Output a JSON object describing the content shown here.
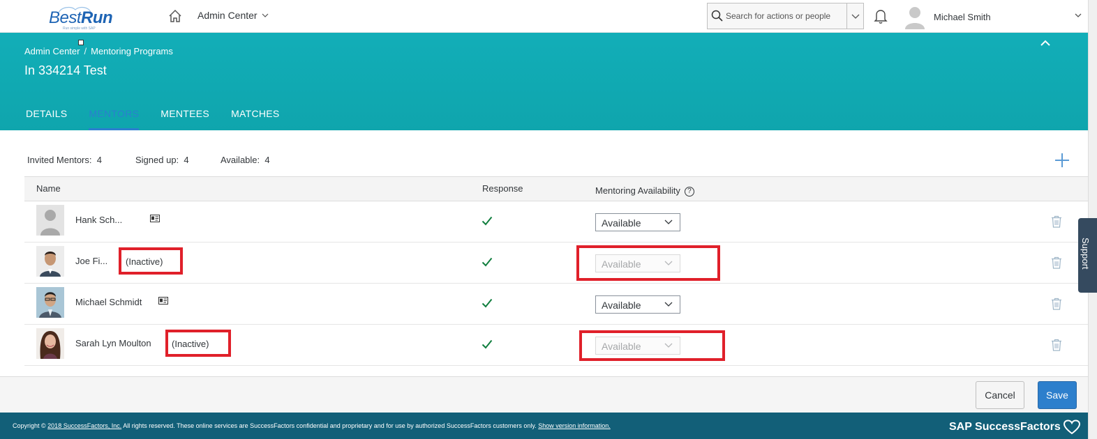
{
  "shell": {
    "logo_text_a": "Best",
    "logo_text_b": "Run",
    "logo_sub": "Run simple with SAP",
    "menu_label": "Admin Center",
    "search_placeholder": "Search for actions or people",
    "user_name": "Michael Smith"
  },
  "header": {
    "breadcrumb": [
      "Admin Center",
      "/",
      "Mentoring Programs"
    ],
    "title": "In 334214 Test",
    "tabs": [
      "DETAILS",
      "MENTORS",
      "MENTEES",
      "MATCHES"
    ],
    "active_tab": "MENTORS"
  },
  "summary": {
    "invited_label": "Invited Mentors:",
    "invited_value": "4",
    "signed_label": "Signed up:",
    "signed_value": "4",
    "available_label": "Available:",
    "available_value": "4"
  },
  "table": {
    "columns": [
      "Name",
      "Response",
      "Mentoring Availability"
    ],
    "rows": [
      {
        "name": "Hank Sch...",
        "status": "",
        "response": "✓",
        "availability": "Available",
        "disabled": false
      },
      {
        "name": "Joe Fi...",
        "status": "(Inactive)",
        "response": "✓",
        "availability": "Available",
        "disabled": true
      },
      {
        "name": "Michael Schmidt",
        "status": "",
        "response": "✓",
        "availability": "Available",
        "disabled": false
      },
      {
        "name": "Sarah Lyn Moulton",
        "status": "(Inactive)",
        "response": "✓",
        "availability": "Available",
        "disabled": true
      }
    ]
  },
  "support_label": "Support",
  "actions": {
    "cancel": "Cancel",
    "save": "Save"
  },
  "footer": {
    "copyright_prefix": "Copyright ©",
    "copyright_link": "2018 SuccessFactors, Inc.",
    "copyright_text": "All rights reserved. These online services are SuccessFactors confidential and proprietary and for use by authorized SuccessFactors customers only.",
    "version_link": "Show version information.",
    "brand": "SAP SuccessFactors"
  },
  "colors": {
    "header_teal": "#12aeb8",
    "active_tab": "#2b7fcf",
    "save_blue": "#2d7fcc",
    "footer": "#125f78",
    "highlight_red": "#e0202a",
    "check_green": "#107e3e"
  }
}
